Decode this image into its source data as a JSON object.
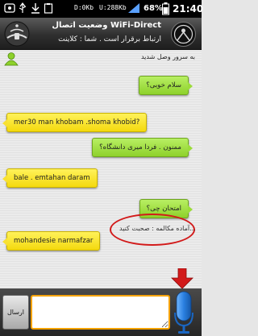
{
  "status_bar": {
    "download_speed": "D:0Kb",
    "upload_speed": "U:288Kb",
    "battery_percent": "68%",
    "time": "21:40"
  },
  "header": {
    "title": "وضعیت اتصال WiFi-Direct",
    "status": "ارتباط برقرار است . شما : کلاینت"
  },
  "chat": {
    "welcome": "به سرور وصل شدید",
    "messages": [
      {
        "side": "right",
        "color": "green",
        "text": "سلام خوبی؟"
      },
      {
        "side": "left",
        "color": "yellow",
        "text": "mer30 man khobam .shoma khobid?"
      },
      {
        "side": "right",
        "color": "green",
        "text": "ممنون . فردا میری دانشگاه؟"
      },
      {
        "side": "left",
        "color": "yellow",
        "text": "bale . emtahan daram"
      },
      {
        "side": "right",
        "color": "green",
        "text": "امتحان چی؟"
      },
      {
        "side": "left",
        "color": "yellow",
        "text": "mohandesie narmafzar"
      }
    ],
    "typing_indicator": "آماده مکالمه : صحبت کنید..."
  },
  "input_bar": {
    "send_label": "ارسال",
    "message_value": "",
    "mic_icon": "microphone-icon"
  },
  "colors": {
    "bubble_green": "#9bdc3a",
    "bubble_yellow": "#f8e033",
    "input_border": "#f5a200",
    "highlight_red": "#d21a1a",
    "mic_blue": "#2a7fe0"
  }
}
